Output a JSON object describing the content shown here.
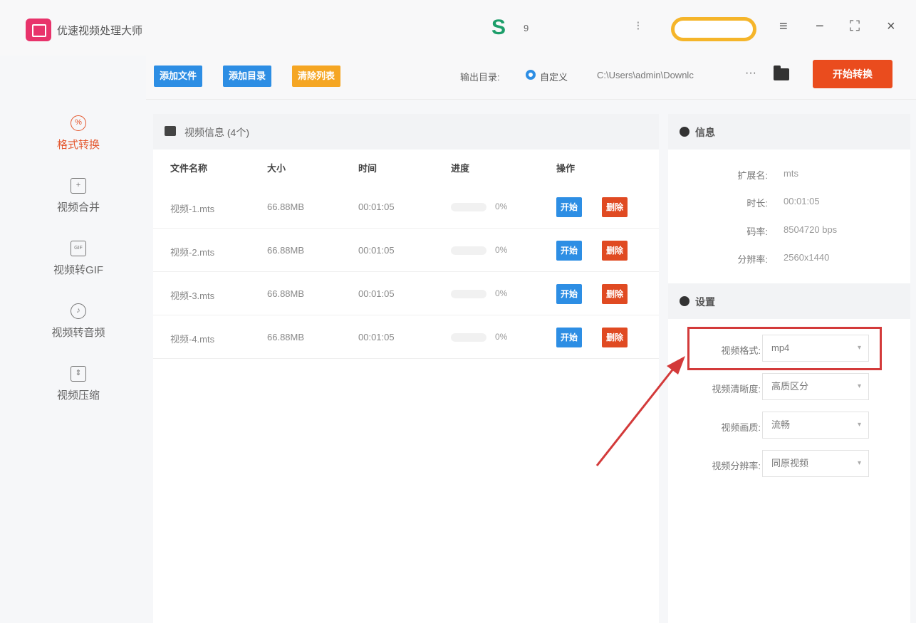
{
  "app": {
    "title": "优速视频处理大师",
    "s_badge": "S",
    "s_count": "9",
    "sep_glyph": "⁝"
  },
  "window_controls": {
    "menu_icon": "≡",
    "minimize_icon": "−",
    "maximize_icon": "⛶",
    "close_icon": "×"
  },
  "toolbar": {
    "add_file": "添加文件",
    "add_dir": "添加目录",
    "clear_list": "清除列表",
    "output_label": "输出目录:",
    "radio_label": "自定义",
    "output_path": "C:\\Users\\admin\\Downlc",
    "dots": "···",
    "start_convert": "开始转换"
  },
  "sidebar": {
    "items": [
      {
        "label": "格式转换",
        "icon": "format-convert-icon",
        "glyph": "%"
      },
      {
        "label": "视频合并",
        "icon": "merge-icon",
        "glyph": "+"
      },
      {
        "label": "视频转GIF",
        "icon": "gif-icon",
        "glyph": "GIF"
      },
      {
        "label": "视频转音频",
        "icon": "audio-icon",
        "glyph": "♪"
      },
      {
        "label": "视频压缩",
        "icon": "compress-icon",
        "glyph": "⇕"
      }
    ]
  },
  "main": {
    "header": "视频信息 (4个)",
    "columns": [
      "文件名称",
      "大小",
      "时间",
      "进度",
      "操作"
    ],
    "rows": [
      {
        "name": "视频-1.mts",
        "size": "66.88MB",
        "time": "00:01:05",
        "progress": "0%",
        "progress_frac": 0,
        "start": "开始",
        "delete": "删除"
      },
      {
        "name": "视频-2.mts",
        "size": "66.88MB",
        "time": "00:01:05",
        "progress": "0%",
        "progress_frac": 0,
        "start": "开始",
        "delete": "删除"
      },
      {
        "name": "视频-3.mts",
        "size": "66.88MB",
        "time": "00:01:05",
        "progress": "0%",
        "progress_frac": 0,
        "start": "开始",
        "delete": "删除"
      },
      {
        "name": "视频-4.mts",
        "size": "66.88MB",
        "time": "00:01:05",
        "progress": "0%",
        "progress_frac": 0,
        "start": "开始",
        "delete": "删除"
      }
    ]
  },
  "info": {
    "title": "信息",
    "ext_label": "扩展名:",
    "ext": "mts",
    "duration_label": "时长:",
    "duration": "00:01:05",
    "bitrate_label": "码率:",
    "bitrate": "8504720 bps",
    "resolution_label": "分辨率:",
    "resolution": "2560x1440"
  },
  "settings": {
    "title": "设置",
    "format_label": "视频格式:",
    "format": "mp4",
    "quality_label": "视频清晰度:",
    "quality": "高质区分",
    "fps_label": "视频画质:",
    "fps": "流畅",
    "res_label": "视频分辨率:",
    "res": "同原视频"
  },
  "colors": {
    "accent_blue": "#2d8ee4",
    "accent_orange": "#f5a623",
    "accent_red": "#ea4c1e",
    "highlight": "#d33a3a"
  }
}
